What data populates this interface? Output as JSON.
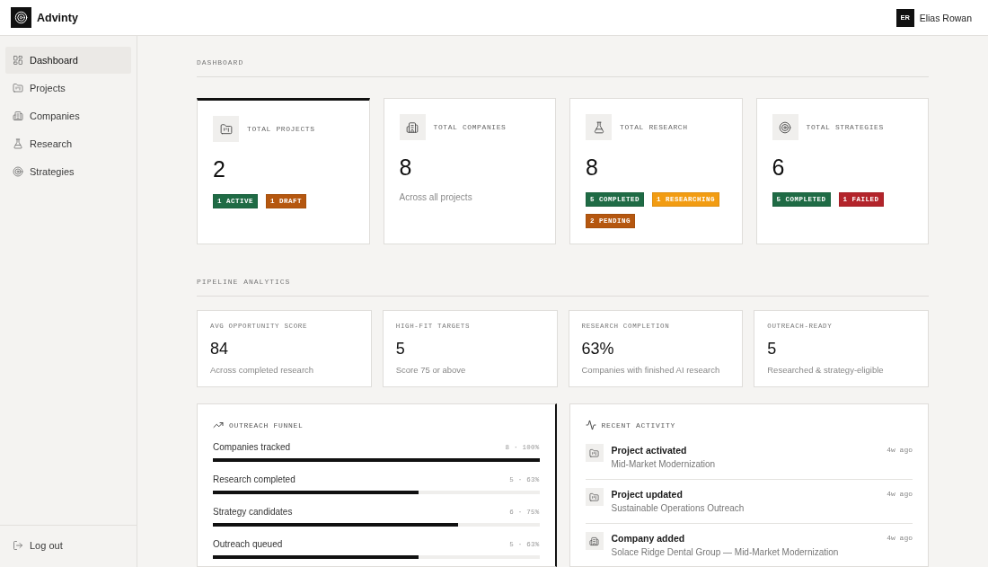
{
  "app": {
    "name": "Advinty"
  },
  "user": {
    "initials": "ER",
    "name": "Elias Rowan"
  },
  "sidebar": {
    "items": [
      {
        "kind": "dashboard",
        "label": "Dashboard",
        "selected": true
      },
      {
        "kind": "projects",
        "label": "Projects",
        "selected": false
      },
      {
        "kind": "companies",
        "label": "Companies",
        "selected": false
      },
      {
        "kind": "research",
        "label": "Research",
        "selected": false
      },
      {
        "kind": "strategies",
        "label": "Strategies",
        "selected": false
      }
    ],
    "logout": {
      "label": "Log out"
    }
  },
  "dashboard": {
    "title": "DASHBOARD",
    "stats": [
      {
        "kind": "projects",
        "title": "TOTAL PROJECTS",
        "value": "2",
        "selected": true,
        "badges": [
          {
            "label": "1 ACTIVE",
            "color": "#1f6b45"
          },
          {
            "label": "1 DRAFT",
            "color": "#b5570f"
          }
        ]
      },
      {
        "kind": "companies",
        "title": "TOTAL COMPANIES",
        "value": "8",
        "selected": false,
        "note": "Across all projects"
      },
      {
        "kind": "research",
        "title": "TOTAL RESEARCH",
        "value": "8",
        "selected": false,
        "badges": [
          {
            "label": "5 COMPLETED",
            "color": "#1f6b45"
          },
          {
            "label": "1 RESEARCHING",
            "color": "#f29c12"
          },
          {
            "label": "2 PENDING",
            "color": "#b5570f"
          }
        ]
      },
      {
        "kind": "strategies",
        "title": "TOTAL STRATEGIES",
        "value": "6",
        "selected": false,
        "badges": [
          {
            "label": "5 COMPLETED",
            "color": "#1f6b45"
          },
          {
            "label": "1 FAILED",
            "color": "#b3242b"
          }
        ]
      }
    ]
  },
  "pipeline": {
    "title": "PIPELINE ANALYTICS",
    "metrics": [
      {
        "label": "AVG OPPORTUNITY SCORE",
        "value": "84",
        "note": "Across completed research"
      },
      {
        "label": "HIGH-FIT TARGETS",
        "value": "5",
        "note": "Score 75 or above"
      },
      {
        "label": "RESEARCH COMPLETION",
        "value": "63%",
        "note": "Companies with finished AI research"
      },
      {
        "label": "OUTREACH-READY",
        "value": "5",
        "note": "Researched & strategy-eligible"
      }
    ]
  },
  "funnel": {
    "title": "OUTREACH FUNNEL",
    "selected": true,
    "stages": [
      {
        "label": "Companies tracked",
        "reading": "8 · 100%",
        "level": 1.0
      },
      {
        "label": "Research completed",
        "reading": "5 · 63%",
        "level": 0.63
      },
      {
        "label": "Strategy candidates",
        "reading": "6 · 75%",
        "level": 0.75
      },
      {
        "label": "Outreach queued",
        "reading": "5 · 63%",
        "level": 0.63
      }
    ]
  },
  "activity": {
    "title": "RECENT ACTIVITY",
    "selected": false,
    "items": [
      {
        "kind": "projects",
        "title": "Project activated",
        "detail": "Mid-Market Modernization",
        "time": "4w ago"
      },
      {
        "kind": "projects",
        "title": "Project updated",
        "detail": "Sustainable Operations Outreach",
        "time": "4w ago"
      },
      {
        "kind": "companies",
        "title": "Company added",
        "detail": "Solace Ridge Dental Group — Mid-Market Modernization",
        "time": "4w ago"
      }
    ]
  }
}
